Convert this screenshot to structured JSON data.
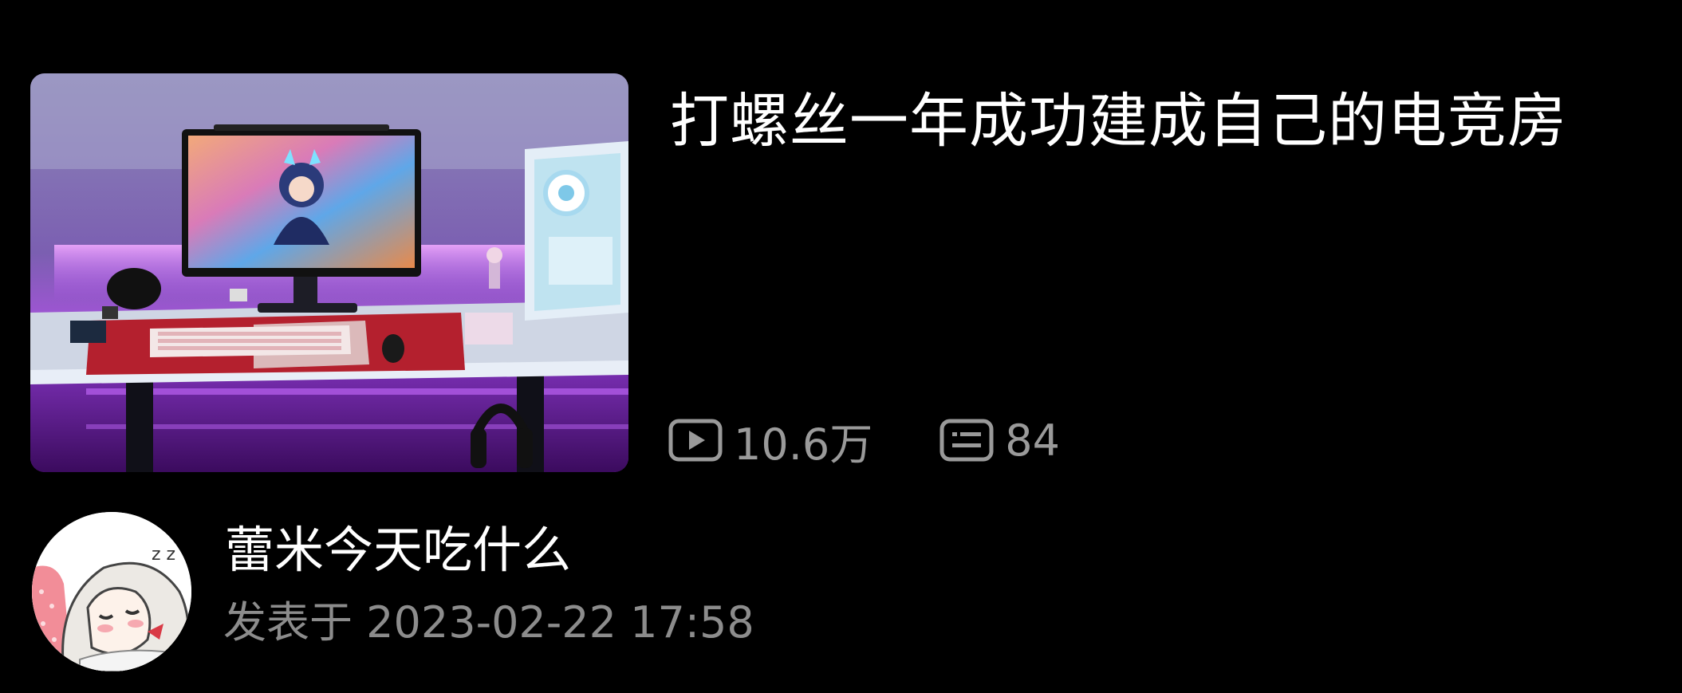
{
  "post": {
    "title": "打螺丝一年成功建成自己的电竞房",
    "thumbnail_icon": "gaming-room-photo",
    "stats": {
      "views": "10.6万",
      "views_icon": "play-video-icon",
      "comments": "84",
      "comments_icon": "comment-bubble-icon"
    }
  },
  "author": {
    "name": "蕾米今天吃什么",
    "avatar_icon": "anime-girl-avatar",
    "posted_label": "发表于 2023-02-22 17:58"
  },
  "colors": {
    "background": "#000000",
    "title": "#ffffff",
    "stats_text": "#9a9a9a",
    "meta_text": "#8c8c8c",
    "ambient_purple": "#b14cff"
  }
}
